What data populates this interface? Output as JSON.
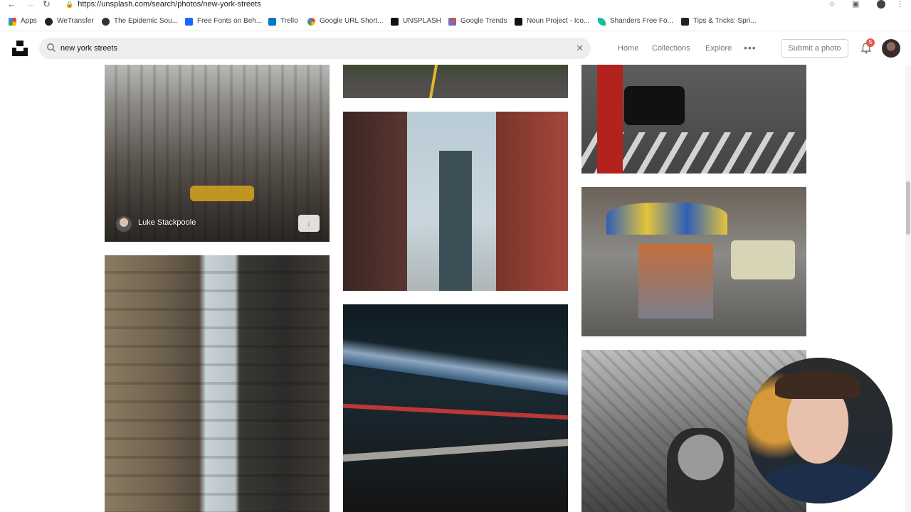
{
  "browser": {
    "url": "https://unsplash.com/search/photos/new-york-streets",
    "bookmarks": [
      {
        "label": "Apps",
        "icon": "apps-grid-icon",
        "color": "#ea4335"
      },
      {
        "label": "WeTransfer",
        "icon": "wetransfer-icon",
        "color": "#222222"
      },
      {
        "label": "The Epidemic Sou...",
        "icon": "epidemic-sound-icon",
        "color": "#333333"
      },
      {
        "label": "Free Fonts on Beh...",
        "icon": "behance-icon",
        "color": "#1769ff"
      },
      {
        "label": "Trello",
        "icon": "trello-icon",
        "color": "#0079bf"
      },
      {
        "label": "Google URL Short...",
        "icon": "google-icon",
        "color": "#4285f4"
      },
      {
        "label": "UNSPLASH",
        "icon": "unsplash-icon",
        "color": "#111111"
      },
      {
        "label": "Google Trends",
        "icon": "google-trends-icon",
        "color": "#ea4335"
      },
      {
        "label": "Noun Project - Ico...",
        "icon": "noun-project-icon",
        "color": "#111111"
      },
      {
        "label": "Shanders Free Fo...",
        "icon": "feather-icon",
        "color": "#1abc9c"
      },
      {
        "label": "Tips & Tricks: Spri...",
        "icon": "bookmark-icon",
        "color": "#222222"
      }
    ]
  },
  "header": {
    "search_value": "new york streets",
    "nav": [
      "Home",
      "Collections",
      "Explore"
    ],
    "more_icon": "more-dots-icon",
    "submit_label": "Submit a photo",
    "notifications_count": "5"
  },
  "photos": {
    "featured_author": "Luke Stackpoole"
  },
  "colors": {
    "accent": "#111111",
    "badge": "#e25950",
    "search_bg": "#eeeeee"
  }
}
